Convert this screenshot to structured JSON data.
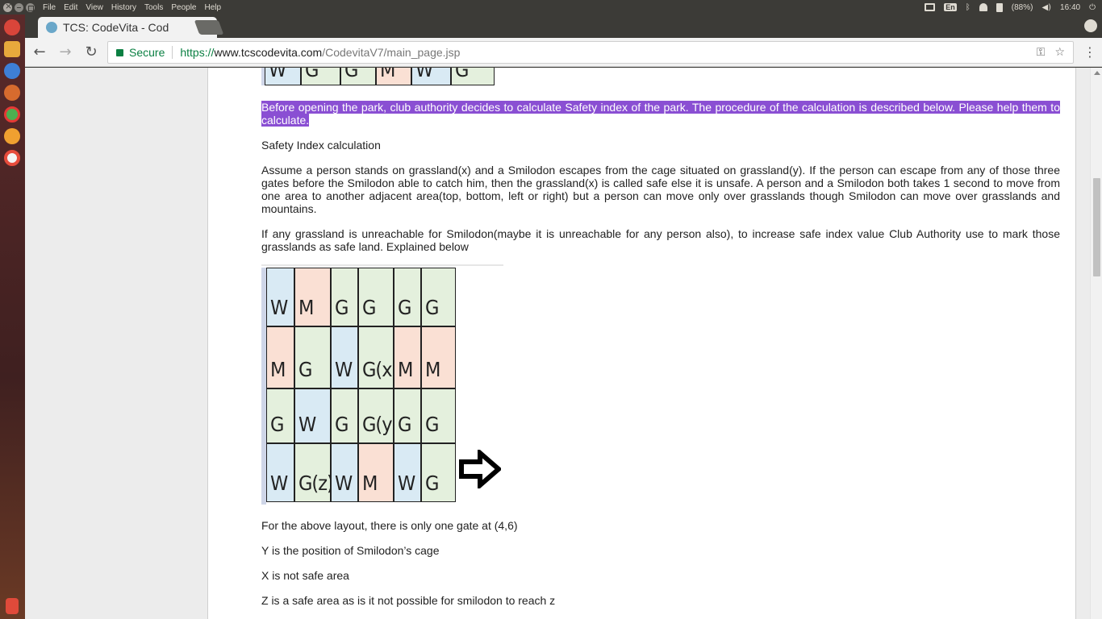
{
  "os_menubar": {
    "menus": [
      "File",
      "Edit",
      "View",
      "History",
      "Tools",
      "People",
      "Help"
    ],
    "keyboard": "En",
    "battery": "(88%)",
    "clock": "16:40"
  },
  "browser": {
    "tab_title": "TCS: CodeVita - Cod",
    "secure_label": "Secure",
    "url_scheme": "https://",
    "url_host": "www.tcscodevita.com",
    "url_path": "/CodevitaV7/main_page.jsp"
  },
  "content": {
    "top_grid_row": [
      "W",
      "G",
      "G",
      "M",
      "W",
      "G"
    ],
    "highlighted_paragraph": "Before opening the park, club authority decides to calculate Safety index of the park. The procedure of the calculation is described below. Please help them to calculate.",
    "heading": "Safety Index calculation",
    "para1": "Assume a person stands on grassland(x) and a Smilodon escapes from the cage situated on grassland(y). If the person can escape from any of those three gates before the Smilodon able to catch him, then the grassland(x) is called safe else it is unsafe. A person and a Smilodon both takes 1 second to move from one area to another adjacent area(top, bottom, left or right) but a person can move only over grasslands though Smilodon can move over grasslands and mountains.",
    "para2": "If any grassland is unreachable for Smilodon(maybe it is unreachable for any person also), to increase safe index value Club Authority use to mark those grasslands as safe land. Explained below",
    "grid": [
      [
        "W",
        "M",
        "G",
        "G",
        "G",
        "G"
      ],
      [
        "M",
        "G",
        "W",
        "G(x)",
        "M",
        "M"
      ],
      [
        "G",
        "W",
        "G",
        "G(y)",
        "G",
        "G"
      ],
      [
        "W",
        "G(z)",
        "W",
        "M",
        "W",
        "G"
      ]
    ],
    "line1": "For the above layout, there is only one gate at (4,6)",
    "line2": "Y is the position of Smilodon’s cage",
    "line3": "X is not safe area",
    "line4": "Z is a safe area as is it not possible for smilodon to reach z"
  }
}
